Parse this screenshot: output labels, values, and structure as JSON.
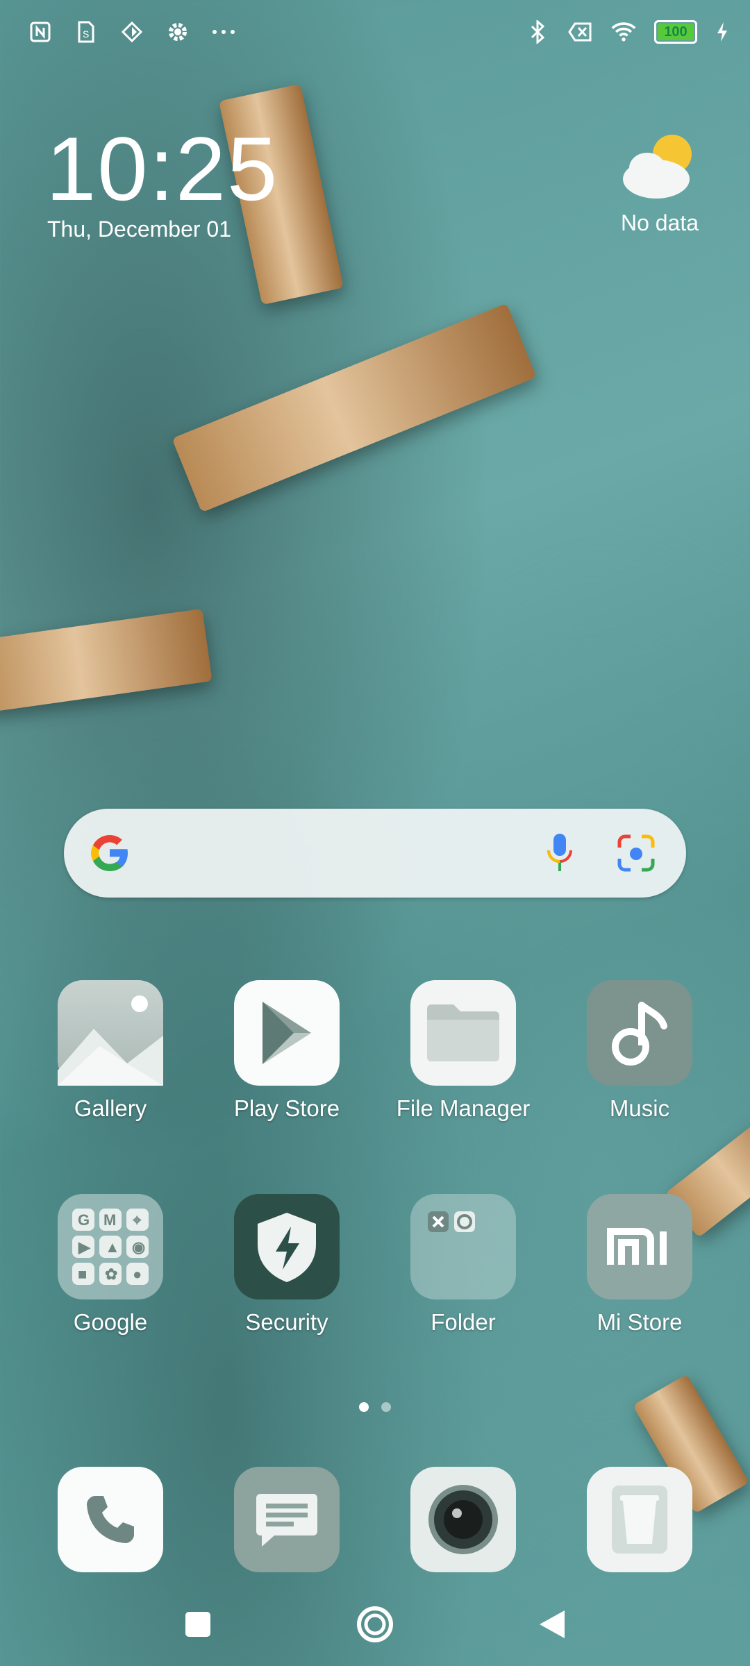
{
  "status_bar": {
    "left_icons": [
      "nfc-icon",
      "sim-icon",
      "vpn-icon",
      "settings-icon",
      "more-icon"
    ],
    "right_icons": [
      "bluetooth-icon",
      "no-sim-icon",
      "wifi-icon",
      "battery-icon",
      "charging-icon"
    ],
    "battery_level": "100"
  },
  "clock_widget": {
    "time": "10:25",
    "date": "Thu, December 01"
  },
  "weather_widget": {
    "icon": "partly-cloudy-icon",
    "text": "No data"
  },
  "search_widget": {
    "logo": "google-logo",
    "mic": "voice-search-icon",
    "lens": "google-lens-icon"
  },
  "apps_row1": [
    {
      "label": "Gallery",
      "icon": "gallery-icon"
    },
    {
      "label": "Play Store",
      "icon": "play-store-icon"
    },
    {
      "label": "File Manager",
      "icon": "file-manager-icon"
    },
    {
      "label": "Music",
      "icon": "music-icon"
    }
  ],
  "apps_row2": [
    {
      "label": "Google",
      "icon": "google-folder-icon"
    },
    {
      "label": "Security",
      "icon": "security-icon"
    },
    {
      "label": "Folder",
      "icon": "folder-icon"
    },
    {
      "label": "Mi Store",
      "icon": "mi-store-icon"
    }
  ],
  "page_indicator": {
    "pages": 2,
    "active": 1
  },
  "dock": [
    {
      "icon": "phone-icon"
    },
    {
      "icon": "messages-icon"
    },
    {
      "icon": "camera-icon"
    },
    {
      "icon": "cleaner-icon"
    }
  ],
  "nav_bar": [
    "recents-button",
    "home-button",
    "back-button"
  ]
}
